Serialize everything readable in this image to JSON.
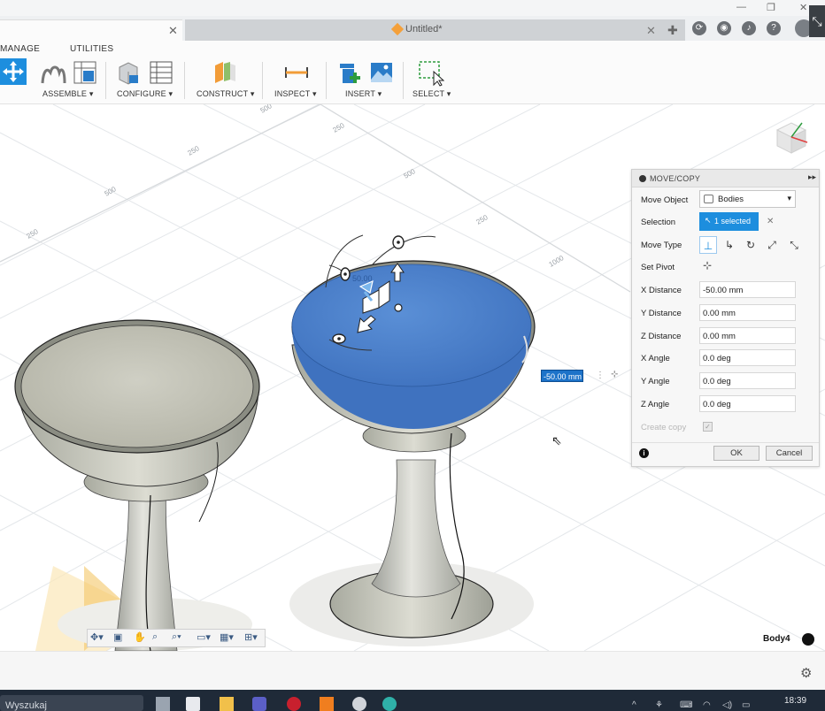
{
  "window": {
    "doc_tab_title": "Untitled*",
    "expand_glyph": "⤡"
  },
  "menu": {
    "tabs": [
      "MANAGE",
      "UTILITIES"
    ]
  },
  "toolbar": {
    "groups": [
      "ASSEMBLE ▾",
      "CONFIGURE ▾",
      "CONSTRUCT ▾",
      "INSPECT ▾",
      "INSERT ▾",
      "SELECT ▾"
    ]
  },
  "viewport": {
    "grid_labels": [
      "500",
      "250",
      "500",
      "250",
      "250",
      "500",
      "250",
      "1000"
    ],
    "distance_value": "-50.00 mm",
    "gizmo_value": "50.00",
    "active_body": "Body4"
  },
  "panel": {
    "title": "MOVE/COPY",
    "rows": {
      "move_object": {
        "label": "Move Object",
        "value": "Bodies"
      },
      "selection": {
        "label": "Selection",
        "value": "1 selected"
      },
      "move_type": {
        "label": "Move Type"
      },
      "set_pivot": {
        "label": "Set Pivot"
      },
      "x_distance": {
        "label": "X Distance",
        "value": "-50.00 mm"
      },
      "y_distance": {
        "label": "Y Distance",
        "value": "0.00 mm"
      },
      "z_distance": {
        "label": "Z Distance",
        "value": "0.00 mm"
      },
      "x_angle": {
        "label": "X Angle",
        "value": "0.0 deg"
      },
      "y_angle": {
        "label": "Y Angle",
        "value": "0.0 deg"
      },
      "z_angle": {
        "label": "Z Angle",
        "value": "0.0 deg"
      },
      "create_copy": {
        "label": "Create copy",
        "checked": true
      }
    },
    "ok_label": "OK",
    "cancel_label": "Cancel"
  },
  "taskbar": {
    "search_text": "Wyszukaj",
    "time": "18:39"
  },
  "colors": {
    "accent": "#1d8ede",
    "selected_body": "#4a7fc8",
    "body_gray": "#c8c8bc"
  }
}
